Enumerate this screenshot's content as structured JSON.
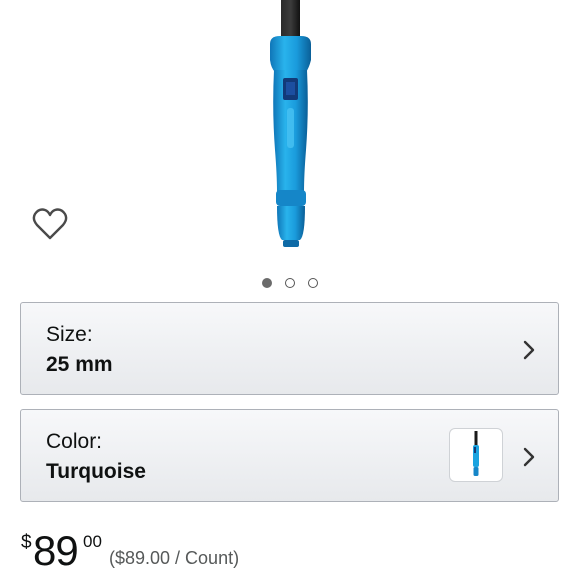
{
  "carousel": {
    "total_images": 3,
    "active_index": 0
  },
  "size_selector": {
    "label": "Size:",
    "value": "25 mm"
  },
  "color_selector": {
    "label": "Color:",
    "value": "Turquoise"
  },
  "price": {
    "currency": "$",
    "whole": "89",
    "fraction": "00",
    "per_unit": "($89.00 / Count)"
  },
  "colors": {
    "product_accent": "#1aa3e0",
    "selector_border": "#adb1b8",
    "secondary_text": "#565959"
  },
  "icons": {
    "wishlist": "heart-outline-icon",
    "chevron": "chevron-right-icon"
  }
}
